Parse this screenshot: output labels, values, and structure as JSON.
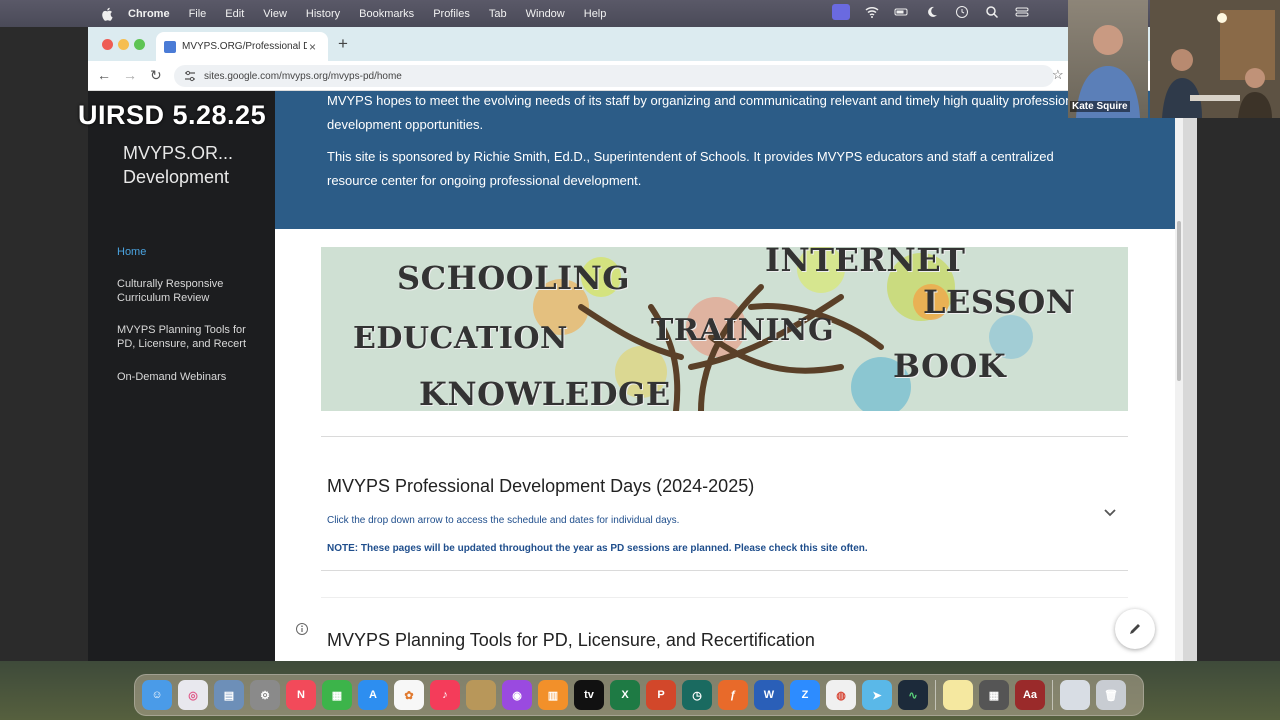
{
  "menubar": {
    "app": "Chrome",
    "items": [
      "File",
      "Edit",
      "View",
      "History",
      "Bookmarks",
      "Profiles",
      "Tab",
      "Window",
      "Help"
    ]
  },
  "browser": {
    "tab_title": "MVYPS.ORG/Professional De",
    "url": "sites.google.com/mvyps.org/mvyps-pd/home"
  },
  "overlay": {
    "caption": "UIRSD 5.28.25"
  },
  "video": {
    "participant_name": "Kate Squire"
  },
  "site": {
    "title": "MVYPS.OR... Development",
    "nav": [
      {
        "label": "Home",
        "active": true
      },
      {
        "label": "Culturally Responsive Curriculum Review"
      },
      {
        "label": "MVYPS Planning Tools for PD, Licensure, and Recert"
      },
      {
        "label": "On-Demand Webinars"
      }
    ],
    "banner": {
      "para1": "MVYPS hopes to meet the evolving needs of its staff by organizing and communicating relevant and timely high quality professional development opportunities.",
      "para2": "This site is sponsored by Richie Smith, Ed.D., Superintendent of Schools. It provides MVYPS educators and staff a centralized resource center for ongoing professional development."
    },
    "image_words": [
      "SCHOOLING",
      "INTERNET",
      "LESSON",
      "EDUCATION",
      "TRAINING",
      "BOOK",
      "KNOWLEDGE"
    ],
    "sections": [
      {
        "title": "MVYPS Professional Development Days (2024-2025)",
        "note1": "Click the drop down arrow to access the schedule and dates for individual days.",
        "note2": "NOTE: These pages will be updated throughout the year as PD sessions are planned. Please check this site often."
      },
      {
        "title": "MVYPS Planning Tools for PD, Licensure, and Recertification"
      }
    ]
  },
  "colors": {
    "banner": "#2c5c87",
    "sidebar": "#1c1d1f",
    "active_nav": "#4aa3df",
    "note_text": "#1f4e8c"
  },
  "dock_icons": [
    "finder-icon",
    "launchpad-icon",
    "preview-icon",
    "settings-icon",
    "news-icon",
    "numbers-icon",
    "app-store-icon",
    "photos-icon",
    "music-icon",
    "notes-icon",
    "podcasts-icon",
    "books-icon",
    "apple-tv-icon",
    "excel-icon",
    "powerpoint-icon",
    "clock-icon",
    "firefox-icon",
    "word-icon",
    "zoom-icon",
    "chrome-icon",
    "maps-icon",
    "stocks-icon",
    "notes2-icon",
    "calculator-icon",
    "dictionary-icon",
    "downloads-icon",
    "trash-icon"
  ]
}
